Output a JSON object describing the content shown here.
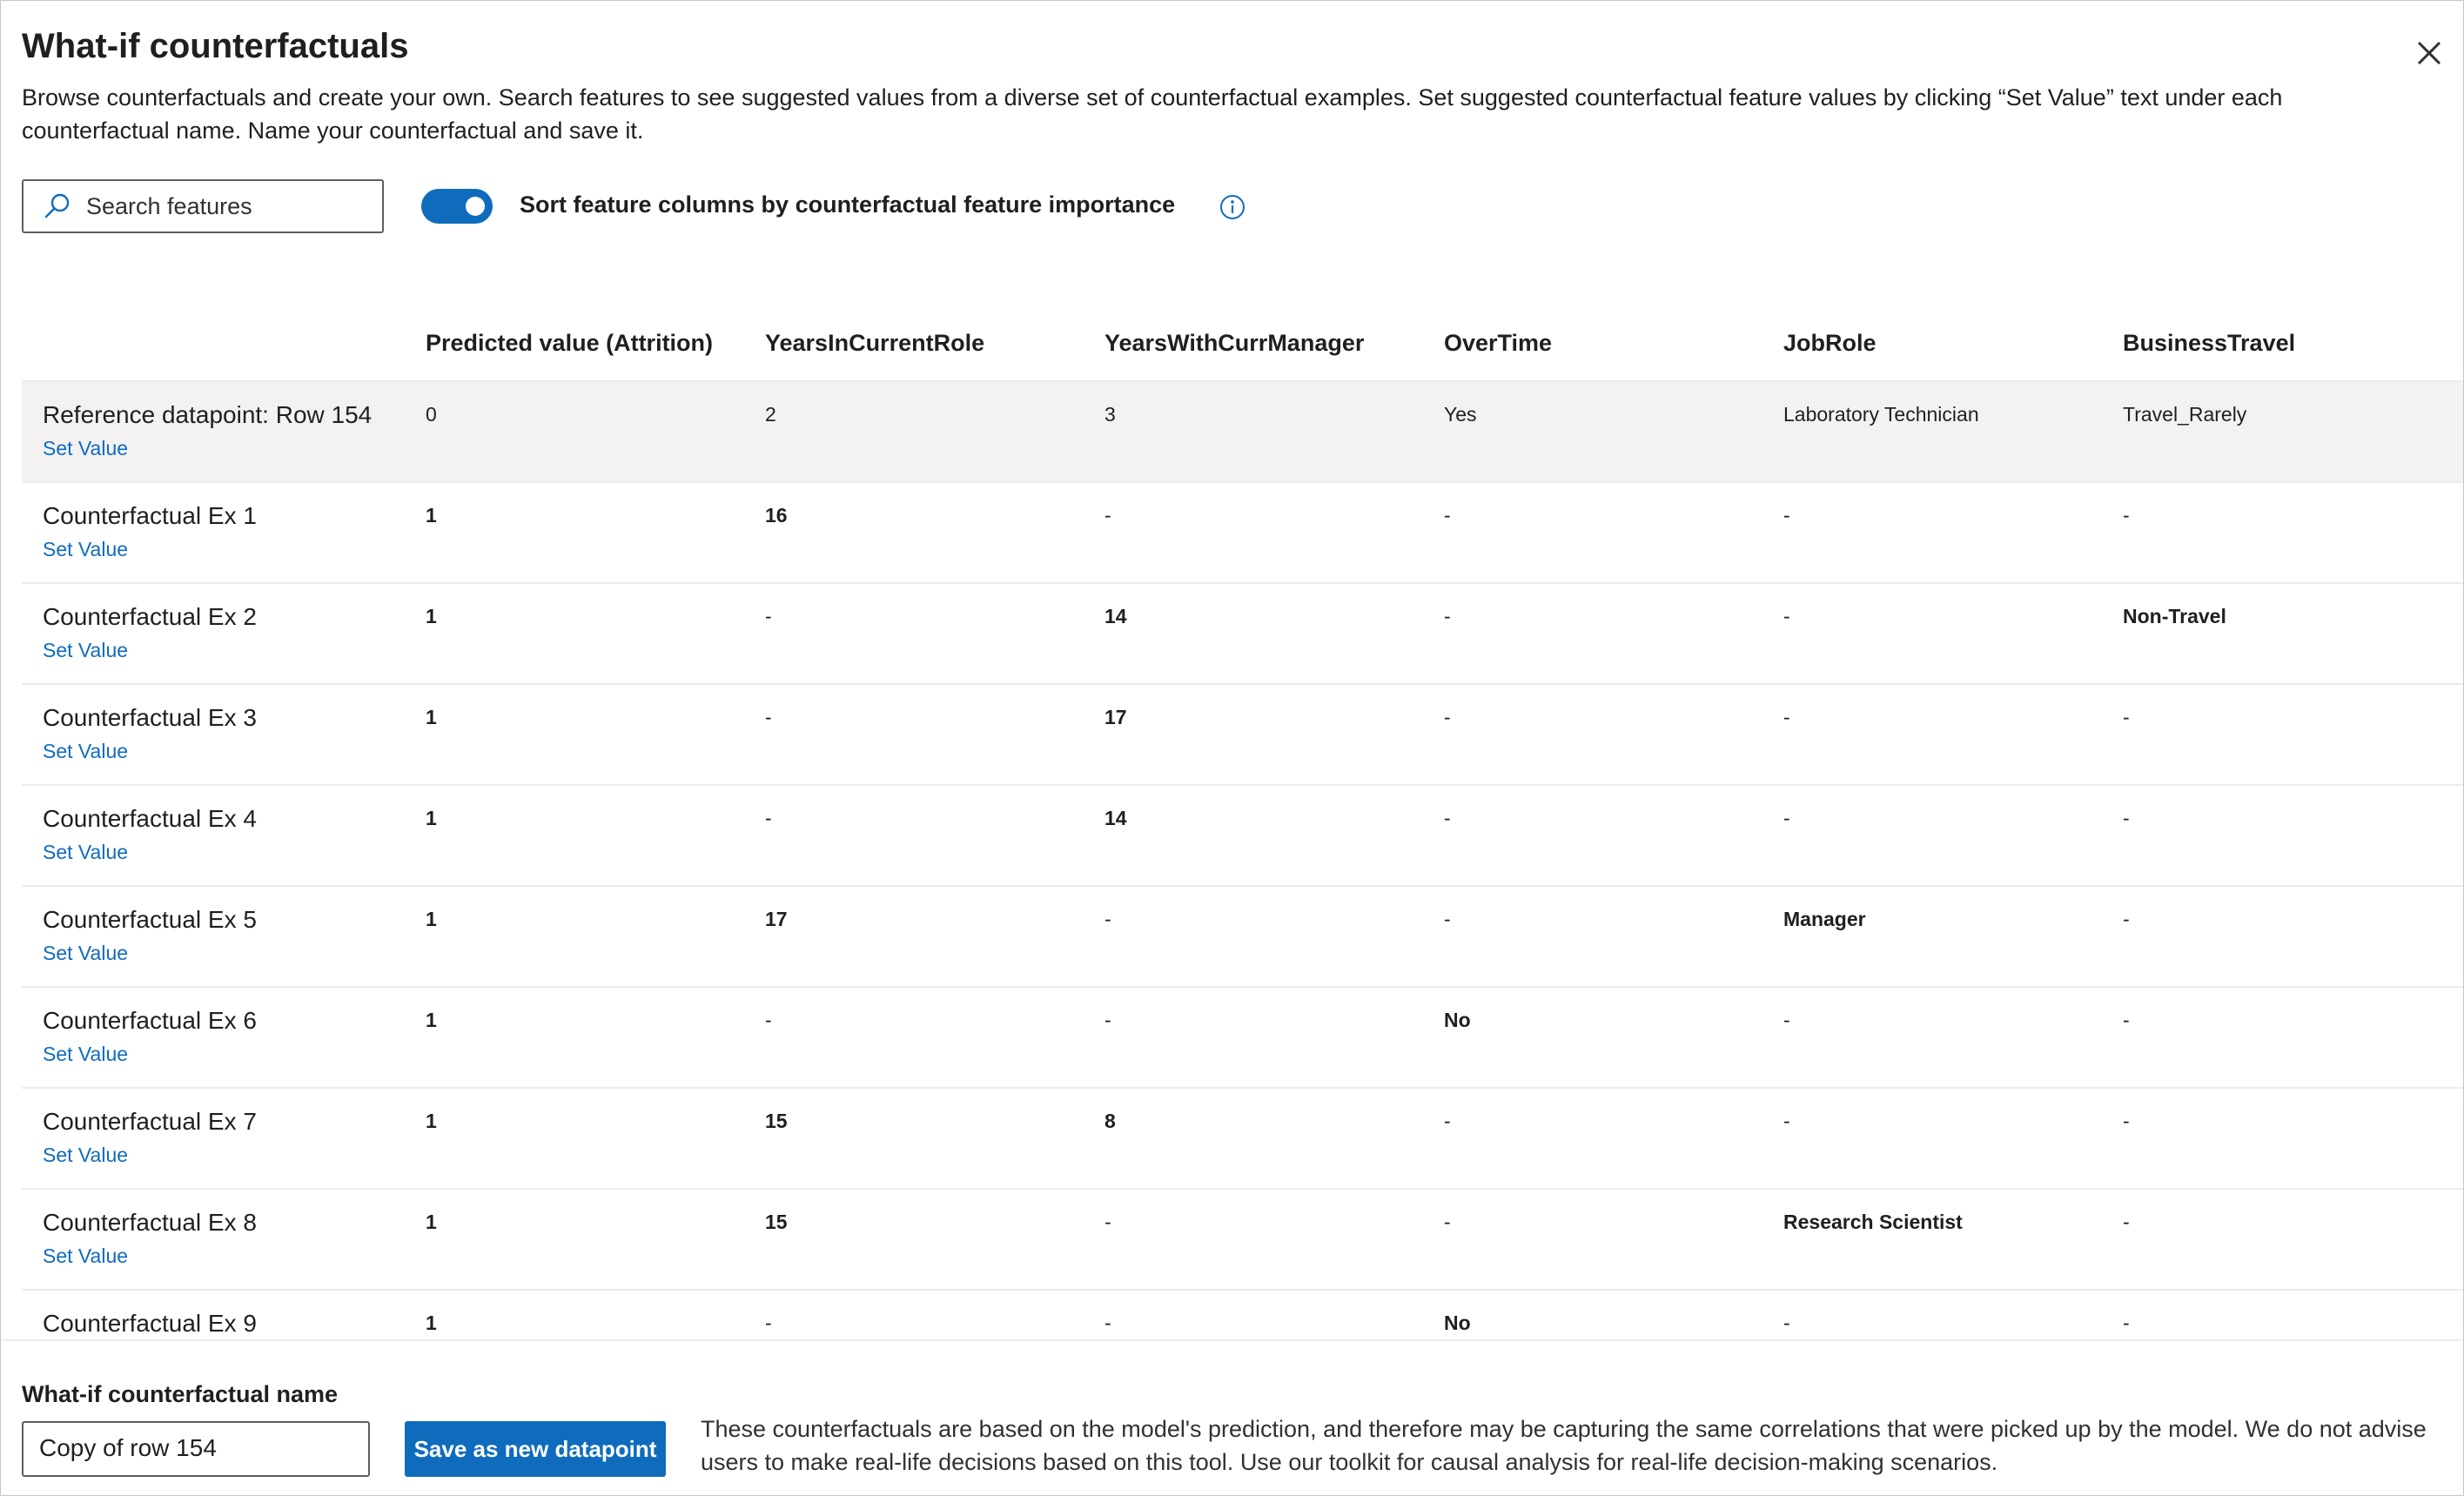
{
  "panel": {
    "title": "What-if counterfactuals",
    "description": "Browse counterfactuals and create your own. Search features to see suggested values from a diverse set of counterfactual examples. Set suggested counterfactual feature values by clicking “Set Value” text under each counterfactual name. Name your counterfactual and save it."
  },
  "search": {
    "placeholder": "Search features"
  },
  "toggle": {
    "label": "Sort feature columns by counterfactual feature importance",
    "on": true
  },
  "table": {
    "columns": [
      "Predicted value (Attrition)",
      "YearsInCurrentRole",
      "YearsWithCurrManager",
      "OverTime",
      "JobRole",
      "BusinessTravel"
    ],
    "set_value_label": "Set Value",
    "rows": [
      {
        "name": "Reference datapoint: Row 154",
        "cells": [
          "0",
          "2",
          "3",
          "Yes",
          "Laboratory Technician",
          "Travel_Rarely"
        ]
      },
      {
        "name": "Counterfactual Ex 1",
        "cells": [
          "1",
          "16",
          "-",
          "-",
          "-",
          "-"
        ]
      },
      {
        "name": "Counterfactual Ex 2",
        "cells": [
          "1",
          "-",
          "14",
          "-",
          "-",
          "Non-Travel"
        ]
      },
      {
        "name": "Counterfactual Ex 3",
        "cells": [
          "1",
          "-",
          "17",
          "-",
          "-",
          "-"
        ]
      },
      {
        "name": "Counterfactual Ex 4",
        "cells": [
          "1",
          "-",
          "14",
          "-",
          "-",
          "-"
        ]
      },
      {
        "name": "Counterfactual Ex 5",
        "cells": [
          "1",
          "17",
          "-",
          "-",
          "Manager",
          "-"
        ]
      },
      {
        "name": "Counterfactual Ex 6",
        "cells": [
          "1",
          "-",
          "-",
          "No",
          "-",
          "-"
        ]
      },
      {
        "name": "Counterfactual Ex 7",
        "cells": [
          "1",
          "15",
          "8",
          "-",
          "-",
          "-"
        ]
      },
      {
        "name": "Counterfactual Ex 8",
        "cells": [
          "1",
          "15",
          "-",
          "-",
          "Research Scientist",
          "-"
        ]
      },
      {
        "name": "Counterfactual Ex 9",
        "cells": [
          "1",
          "-",
          "-",
          "No",
          "-",
          "-"
        ]
      }
    ]
  },
  "footer": {
    "name_label": "What-if counterfactual name",
    "name_value": "Copy of row 154",
    "save_button": "Save as new datapoint",
    "disclaimer": "These counterfactuals are based on the model's prediction, and therefore may be capturing the same correlations that were picked up by the model. We do not advise users to make real-life decisions based on this tool. Use our toolkit for causal analysis for real-life decision-making scenarios."
  },
  "colors": {
    "accent": "#0f6cbd",
    "reference_row_bg": "#f3f2f1"
  }
}
